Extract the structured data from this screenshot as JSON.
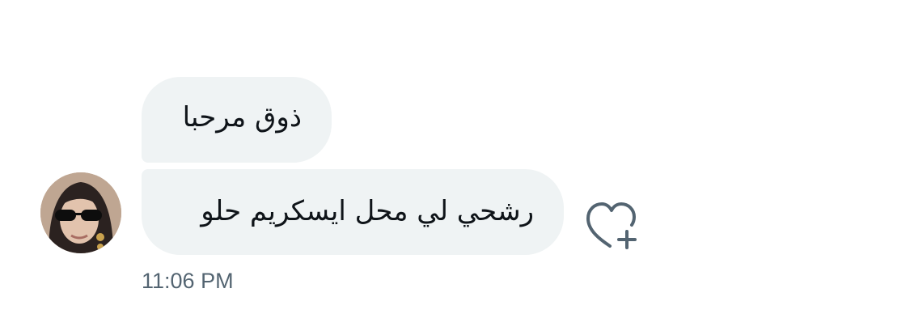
{
  "conversation": {
    "messages": [
      {
        "text": "ذوق مرحبا"
      },
      {
        "text": "رشحي لي محل ايسكريم حلو"
      }
    ],
    "timestamp": "11:06 PM"
  },
  "icons": {
    "avatar": "user-avatar-photo",
    "reaction": "heart-plus-icon"
  },
  "colors": {
    "bubble": "#eff3f4",
    "text": "#0f1419",
    "timestamp": "#536471",
    "icon": "#536471"
  }
}
